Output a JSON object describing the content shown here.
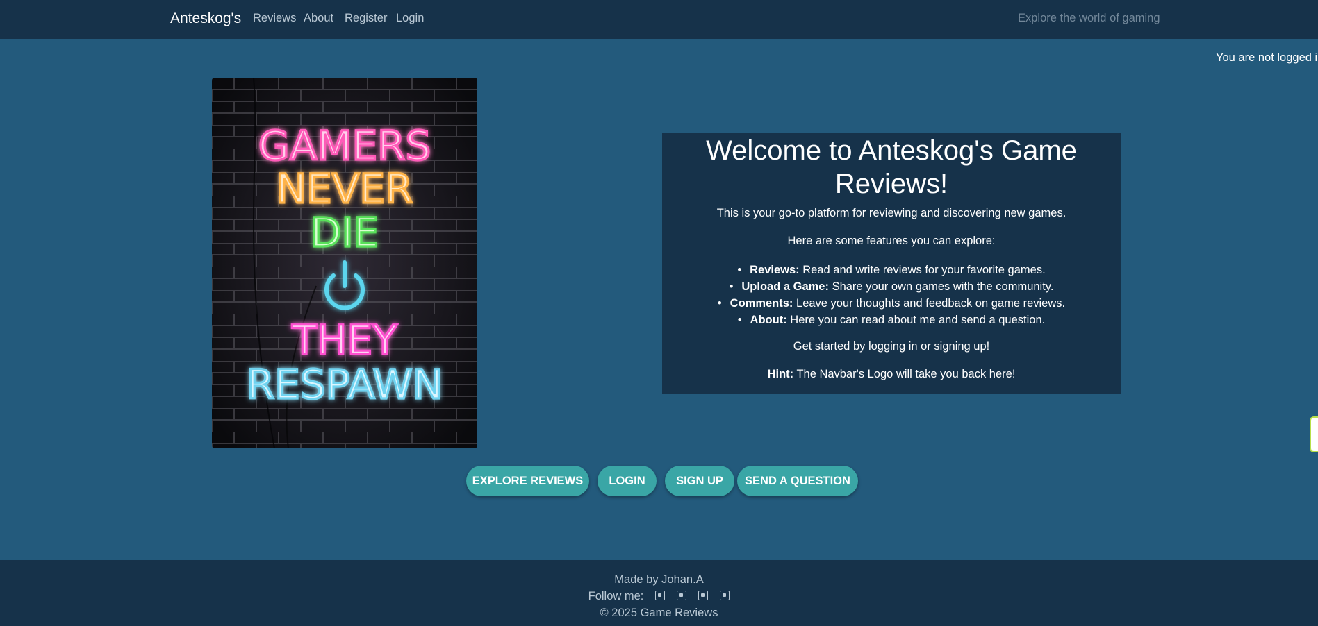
{
  "navbar": {
    "brand": "Anteskog's",
    "links": [
      "Reviews",
      "About",
      "Register",
      "Login"
    ],
    "tagline": "Explore the world of gaming"
  },
  "status": "You are not logged in",
  "poster": {
    "lines": [
      "GAMERS",
      "NEVER",
      "DIE",
      "THEY",
      "RESPAWN"
    ],
    "icon": "power-icon"
  },
  "welcome": {
    "title": "Welcome to Anteskog's Game Reviews!",
    "intro": "This is your go-to platform for reviewing and discovering new games.",
    "features_intro": "Here are some features you can explore:",
    "features": [
      {
        "name": "Reviews:",
        "text": "Read and write reviews for your favorite games."
      },
      {
        "name": "Upload a Game:",
        "text": "Share your own games with the community."
      },
      {
        "name": "Comments:",
        "text": "Leave your thoughts and feedback on game reviews."
      },
      {
        "name": "About:",
        "text": "Here you can read about me and send a question."
      }
    ],
    "get_started": "Get started by logging in or signing up!",
    "hint_label": "Hint:",
    "hint_text": "The Navbar's Logo will take you back here!"
  },
  "buttons": {
    "explore": "Explore Reviews",
    "login": "Login",
    "signup": "Sign Up",
    "question": "Send a Question"
  },
  "footer": {
    "made_by": "Made by Johan.A",
    "follow": "Follow me:",
    "social_icons": [
      "facebook-icon",
      "twitter-icon",
      "instagram-icon",
      "youtube-icon"
    ],
    "copyright": "© 2025 Game Reviews"
  },
  "colors": {
    "background": "#235a7c",
    "navbar": "#16324a",
    "button": "#3aa6a6"
  }
}
